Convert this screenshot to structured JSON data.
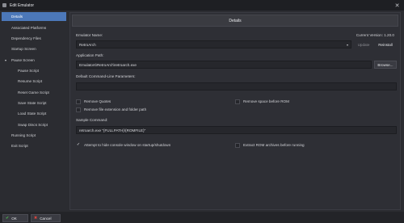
{
  "window": {
    "title": "Edit Emulator",
    "close_icon": "close-icon"
  },
  "sidebar": {
    "items": [
      {
        "label": "Details",
        "selected": true
      },
      {
        "label": "Associated Platforms"
      },
      {
        "label": "Dependency Files"
      },
      {
        "label": "Startup Screen"
      },
      {
        "label": "Pause Screen",
        "expanded": true
      },
      {
        "label": "Pause Script"
      },
      {
        "label": "Resume Script"
      },
      {
        "label": "Reset Game Script"
      },
      {
        "label": "Save State Script"
      },
      {
        "label": "Load State Script"
      },
      {
        "label": "Swap Discs Script"
      },
      {
        "label": "Running Script"
      },
      {
        "label": "Exit Script"
      }
    ]
  },
  "details": {
    "tab_title": "Details",
    "emulator_name_label": "Emulator Name:",
    "current_version": "Current Version: 1.20.0",
    "emulator_name_value": "RetroArch",
    "update_label": "Update",
    "reinstall_label": "Reinstall",
    "app_path_label": "Application Path:",
    "app_path_value": "Emulators\\RetroArch\\retroarch.exe",
    "browse_label": "Browse...",
    "params_label": "Default Command-Line Parameters:",
    "params_value": "",
    "remove_quotes": "Remove Quotes",
    "remove_space": "Remove space before ROM",
    "remove_ext": "Remove file extension and folder path",
    "sample_label": "Sample Command:",
    "sample_value": "retroarch.exe \"{FULLPATH}\\{ROMFILE}\"",
    "hide_console": "Attempt to hide console window on startup/shutdown",
    "extract_rom": "Extract ROM archives before running"
  },
  "footer": {
    "ok_label": "OK",
    "cancel_label": "Cancel"
  },
  "colors": {
    "accent": "#4c78b9",
    "ok": "#4fc04f",
    "cancel": "#e0453d"
  }
}
